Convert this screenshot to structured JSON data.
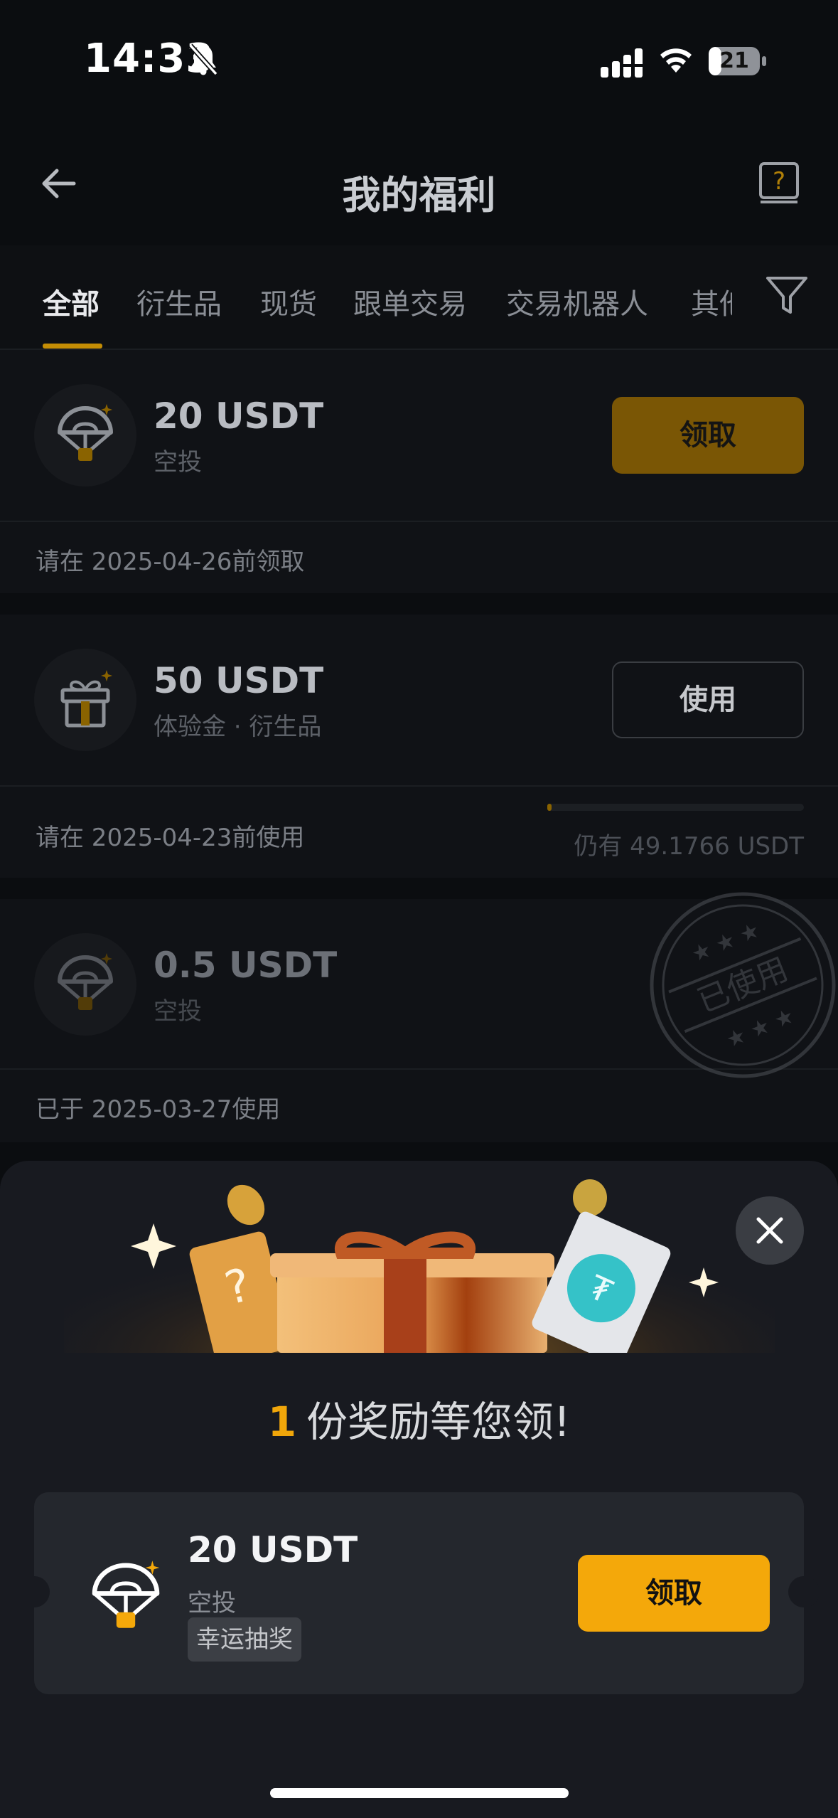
{
  "status_bar": {
    "time": "14:33",
    "battery": "21"
  },
  "header": {
    "title": "我的福利"
  },
  "tabs": [
    "全部",
    "衍生品",
    "现货",
    "跟单交易",
    "交易机器人",
    "其他"
  ],
  "cards": [
    {
      "amount": "20 USDT",
      "type": "空投",
      "action": "领取",
      "note": "请在 2025-04-26前领取"
    },
    {
      "amount": "50 USDT",
      "type": "体验金 · 衍生品",
      "action": "使用",
      "note": "请在 2025-04-23前使用",
      "remaining": "仍有 49.1766 USDT",
      "progress_fraction": 0.017
    },
    {
      "amount": "0.5 USDT",
      "type": "空投",
      "note": "已于 2025-03-27使用",
      "stamp": "已使用"
    }
  ],
  "sheet": {
    "count": "1",
    "headline": "份奖励等您领!",
    "reward": {
      "amount": "20 USDT",
      "type": "空投",
      "badge": "幸运抽奖",
      "action": "领取"
    }
  },
  "colors": {
    "accent": "#f4a80a",
    "accent_dim": "#7a5605",
    "background": "#0b0d10",
    "sheet": "#181a20"
  }
}
